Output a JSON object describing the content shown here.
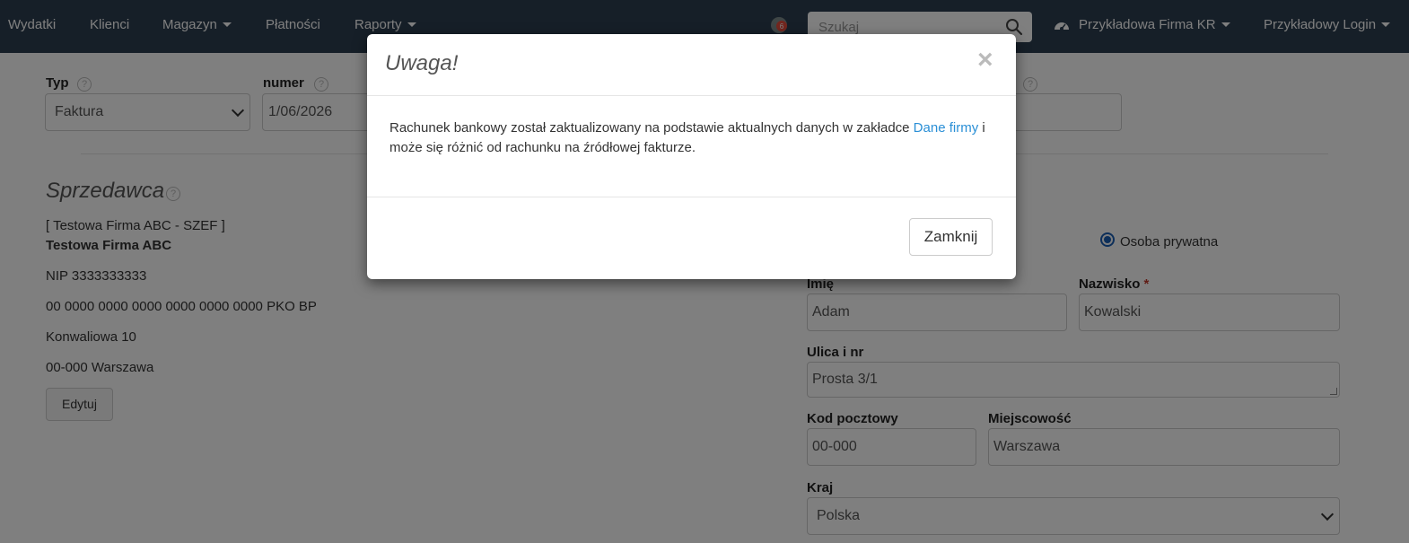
{
  "nav": {
    "items": [
      {
        "label": "Wydatki",
        "dropdown": false
      },
      {
        "label": "Klienci",
        "dropdown": false
      },
      {
        "label": "Magazyn",
        "dropdown": true
      },
      {
        "label": "Płatności",
        "dropdown": false
      },
      {
        "label": "Raporty",
        "dropdown": true
      }
    ],
    "notification_count": "6",
    "search_placeholder": "Szukaj",
    "company": "Przykładowa Firma KR",
    "login": "Przykładowy Login",
    "colors": {
      "bar": "#2c3e50",
      "badge": "#e74c3c"
    }
  },
  "document": {
    "type_label": "Typ",
    "type_value": "Faktura",
    "number_label": "numer",
    "number_value": "1/06/2026"
  },
  "seller": {
    "title": "Sprzedawca",
    "shortname": "[ Testowa Firma ABC - SZEF ]",
    "name": "Testowa Firma ABC",
    "nip": "NIP 3333333333",
    "account": "00 0000 0000 0000 0000 0000 0000 PKO BP",
    "street": "Konwaliowa 10",
    "city": "00-000 Warszawa",
    "edit_label": "Edytuj"
  },
  "buyer": {
    "person_type_label": "Osoba prywatna",
    "first_name_label": "Imię",
    "first_name_value": "Adam",
    "last_name_label": "Nazwisko",
    "required_mark": "*",
    "last_name_value": "Kowalski",
    "street_label": "Ulica i nr",
    "street_value": "Prosta 3/1",
    "postcode_label": "Kod pocztowy",
    "postcode_value": "00-000",
    "city_label": "Miejscowość",
    "city_value": "Warszawa",
    "country_label": "Kraj",
    "country_value": "Polska"
  },
  "modal": {
    "title": "Uwaga!",
    "close_symbol": "×",
    "body_before_link": "Rachunek bankowy został zaktualizowany na podstawie aktualnych danych w zakładce ",
    "link_text": "Dane firmy",
    "body_after_link": " i może się różnić od rachunku na źródłowej fakturze.",
    "close_button": "Zamknij"
  }
}
